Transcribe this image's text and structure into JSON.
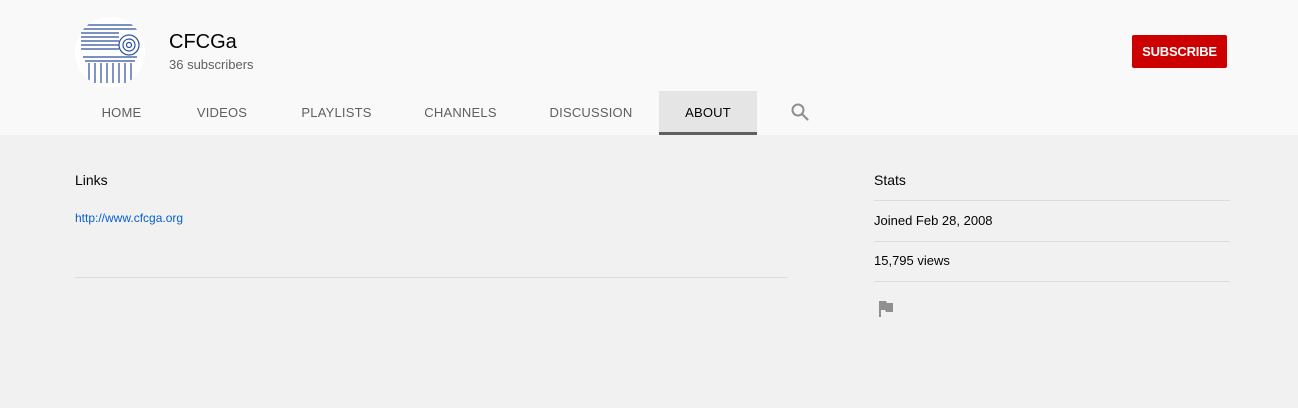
{
  "channel": {
    "name": "CFCGa",
    "subscribers": "36 subscribers",
    "subscribe_label": "SUBSCRIBE",
    "avatar_icon": "ionic-column-capital-logo"
  },
  "tabs": [
    {
      "label": "HOME",
      "active": false
    },
    {
      "label": "VIDEOS",
      "active": false
    },
    {
      "label": "PLAYLISTS",
      "active": false
    },
    {
      "label": "CHANNELS",
      "active": false
    },
    {
      "label": "DISCUSSION",
      "active": false
    },
    {
      "label": "ABOUT",
      "active": true
    }
  ],
  "search_icon": "search-icon",
  "links": {
    "title": "Links",
    "items": [
      "http://www.cfcga.org"
    ]
  },
  "stats": {
    "title": "Stats",
    "joined": "Joined Feb 28, 2008",
    "views": "15,795 views",
    "flag_icon": "flag-icon"
  },
  "colors": {
    "subscribe_bg": "#cc0000",
    "link": "#065fd4",
    "header_bg": "#f9f9f9",
    "page_bg": "#f1f1f1"
  }
}
